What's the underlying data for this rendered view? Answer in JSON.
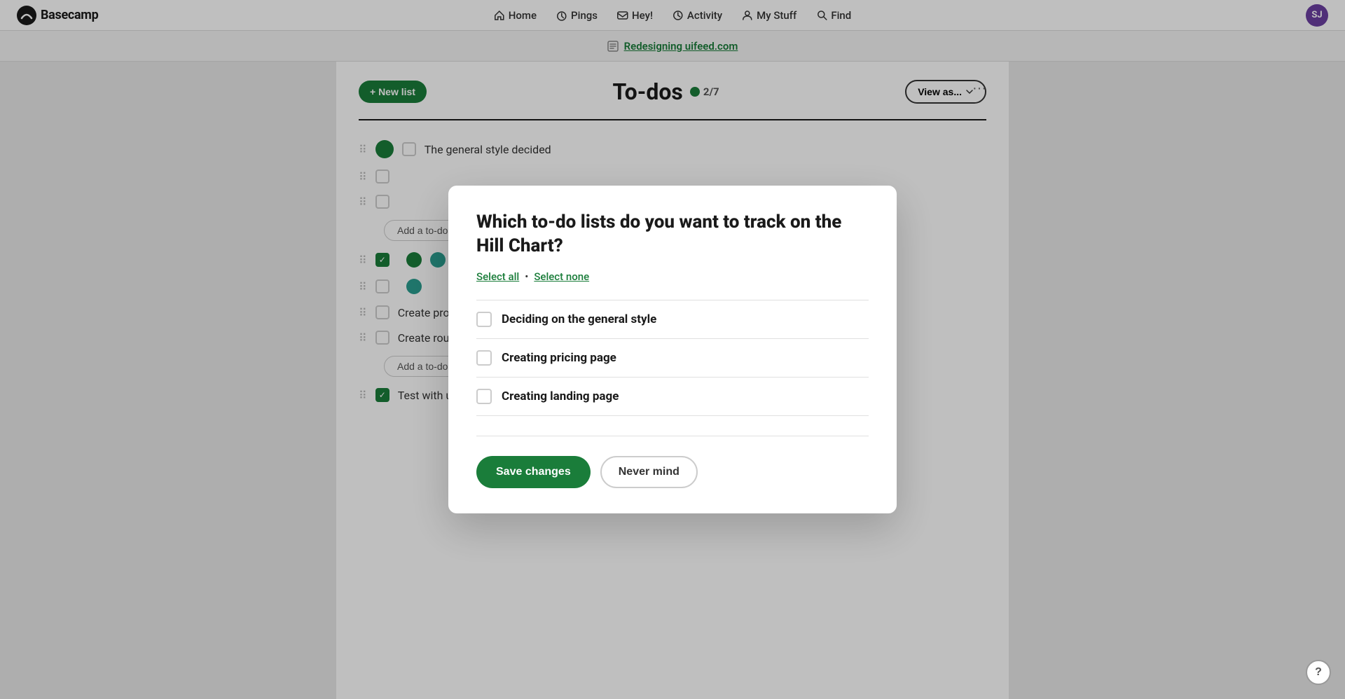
{
  "nav": {
    "brand": "Basecamp",
    "items": [
      {
        "id": "home",
        "label": "Home",
        "icon": "home-icon"
      },
      {
        "id": "pings",
        "label": "Pings",
        "icon": "pings-icon"
      },
      {
        "id": "hey",
        "label": "Hey!",
        "icon": "hey-icon"
      },
      {
        "id": "activity",
        "label": "Activity",
        "icon": "activity-icon"
      },
      {
        "id": "mystuff",
        "label": "My Stuff",
        "icon": "mystuff-icon"
      },
      {
        "id": "find",
        "label": "Find",
        "icon": "find-icon"
      }
    ],
    "avatar_initials": "SJ",
    "avatar_bg": "#6b3fa0"
  },
  "project_bar": {
    "link_text": "Redesigning uifeed.com"
  },
  "todos_page": {
    "title": "To-dos",
    "progress_count": "2/7",
    "new_list_btn": "+ New list",
    "view_as_btn": "View as...",
    "more_options": "···"
  },
  "todo_items": [
    {
      "id": "1",
      "text": "The general style decided",
      "checked": false,
      "has_avatar": true,
      "avatar_color": "green"
    },
    {
      "id": "2",
      "text": "",
      "checked": false,
      "has_avatar": false,
      "avatar_color": ""
    },
    {
      "id": "3",
      "text": "",
      "checked": false,
      "has_avatar": false,
      "avatar_color": ""
    },
    {
      "id": "4",
      "text": "",
      "checked": true,
      "has_avatar": true,
      "avatar_color": "green"
    },
    {
      "id": "5",
      "text": "",
      "checked": false,
      "has_avatar": true,
      "avatar_color": "teal"
    },
    {
      "id": "6",
      "text": "Create prototype in Figma",
      "checked": false,
      "has_avatar": false,
      "avatar_color": ""
    },
    {
      "id": "7",
      "text": "Create rough shape in Balsamiq",
      "checked": false,
      "has_avatar": false,
      "avatar_color": ""
    },
    {
      "id": "8",
      "text": "Test with users on Usertest",
      "checked": true,
      "has_avatar": false,
      "avatar_color": ""
    }
  ],
  "add_todo_label": "Add a to-do",
  "modal": {
    "title": "Which to-do lists do you want to track on the Hill Chart?",
    "select_all_label": "Select all",
    "select_none_label": "Select none",
    "separator": "•",
    "items": [
      {
        "id": "item1",
        "label": "Deciding on the general style",
        "checked": false
      },
      {
        "id": "item2",
        "label": "Creating pricing page",
        "checked": false
      },
      {
        "id": "item3",
        "label": "Creating landing page",
        "checked": false
      }
    ],
    "save_btn": "Save changes",
    "nevermind_btn": "Never mind"
  },
  "help": {
    "icon": "?"
  }
}
